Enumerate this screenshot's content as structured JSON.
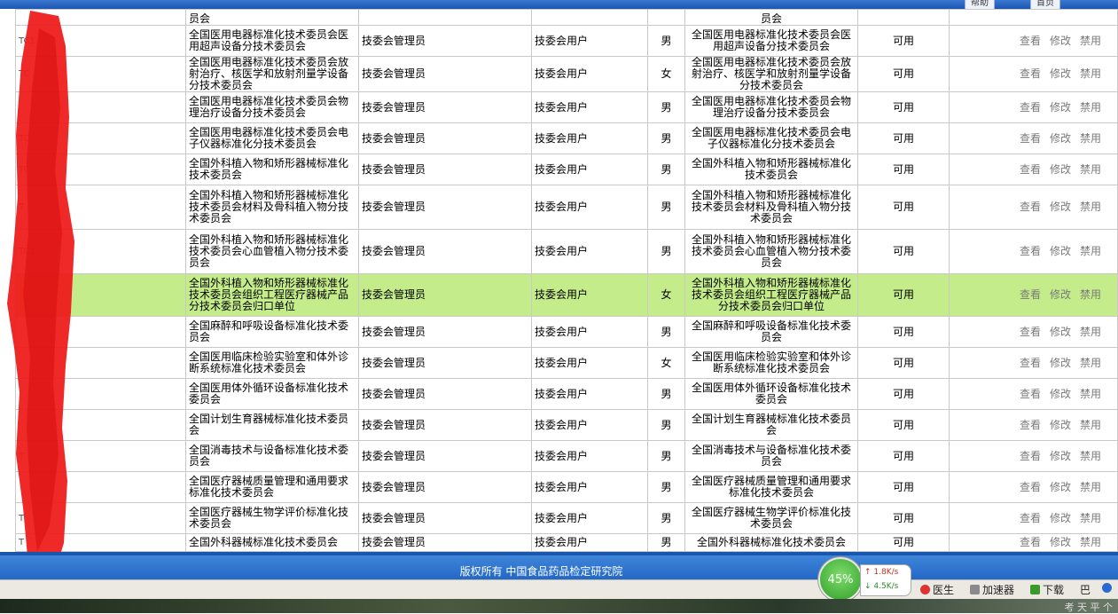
{
  "toolbar": {
    "btn1": "帮助",
    "btn2": "首页"
  },
  "table": {
    "top_partial": {
      "org": "员会",
      "org2": "员会"
    },
    "rows": [
      {
        "id": "TC1",
        "org": "全国医用电器标准化技术委员会医用超声设备分技术委员会",
        "role": "技委会管理员",
        "type": "技委会用户",
        "sex": "男",
        "org2": "全国医用电器标准化技术委员会医用超声设备分技术委员会",
        "status": "可用"
      },
      {
        "id": "TC",
        "org": "全国医用电器标准化技术委员会放射治疗、核医学和放射剂量学设备分技术委员会",
        "role": "技委会管理员",
        "type": "技委会用户",
        "sex": "女",
        "org2": "全国医用电器标准化技术委员会放射治疗、核医学和放射剂量学设备分技术委员会",
        "status": "可用"
      },
      {
        "id": "",
        "org": "全国医用电器标准化技术委员会物理治疗设备分技术委员会",
        "role": "技委会管理员",
        "type": "技委会用户",
        "sex": "男",
        "org2": "全国医用电器标准化技术委员会物理治疗设备分技术委员会",
        "status": "可用"
      },
      {
        "id": "TC",
        "org": "全国医用电器标准化技术委员会电子仪器标准化分技术委员会",
        "role": "技委会管理员",
        "type": "技委会用户",
        "sex": "男",
        "org2": "全国医用电器标准化技术委员会电子仪器标准化分技术委员会",
        "status": "可用"
      },
      {
        "id": "TC",
        "org": "全国外科植入物和矫形器械标准化技术委员会",
        "role": "技委会管理员",
        "type": "技委会用户",
        "sex": "男",
        "org2": "全国外科植入物和矫形器械标准化技术委员会",
        "status": "可用"
      },
      {
        "id": "T",
        "org": "全国外科植入物和矫形器械标准化技术委员会材料及骨科植入物分技术委员会",
        "role": "技委会管理员",
        "type": "技委会用户",
        "sex": "男",
        "org2": "全国外科植入物和矫形器械标准化技术委员会材料及骨科植入物分技术委员会",
        "status": "可用"
      },
      {
        "id": "TC1",
        "org": "全国外科植入物和矫形器械标准化技术委员会心血管植入物分技术委员会",
        "role": "技委会管理员",
        "type": "技委会用户",
        "sex": "男",
        "org2": "全国外科植入物和矫形器械标准化技术委员会心血管植入物分技术委员会",
        "status": "可用"
      },
      {
        "id": "",
        "org": "全国外科植入物和矫形器械标准化技术委员会组织工程医疗器械产品分技术委员会归口单位",
        "role": "技委会管理员",
        "type": "技委会用户",
        "sex": "女",
        "org2": "全国外科植入物和矫形器械标准化技术委员会组织工程医疗器械产品分技术委员会归口单位",
        "status": "可用",
        "highlight": true
      },
      {
        "id": "",
        "org": "全国麻醉和呼吸设备标准化技术委员会",
        "role": "技委会管理员",
        "type": "技委会用户",
        "sex": "男",
        "org2": "全国麻醉和呼吸设备标准化技术委员会",
        "status": "可用"
      },
      {
        "id": "",
        "org": "全国医用临床检验实验室和体外诊断系统标准化技术委员会",
        "role": "技委会管理员",
        "type": "技委会用户",
        "sex": "女",
        "org2": "全国医用临床检验实验室和体外诊断系统标准化技术委员会",
        "status": "可用"
      },
      {
        "id": "",
        "org": "全国医用体外循环设备标准化技术委员会",
        "role": "技委会管理员",
        "type": "技委会用户",
        "sex": "男",
        "org2": "全国医用体外循环设备标准化技术委员会",
        "status": "可用"
      },
      {
        "id": "",
        "org": "全国计划生育器械标准化技术委员会",
        "role": "技委会管理员",
        "type": "技委会用户",
        "sex": "男",
        "org2": "全国计划生育器械标准化技术委员会",
        "status": "可用"
      },
      {
        "id": "T",
        "org": "全国消毒技术与设备标准化技术委员会",
        "role": "技委会管理员",
        "type": "技委会用户",
        "sex": "男",
        "org2": "全国消毒技术与设备标准化技术委员会",
        "status": "可用"
      },
      {
        "id": "",
        "org": "全国医疗器械质量管理和通用要求标准化技术委员会",
        "role": "技委会管理员",
        "type": "技委会用户",
        "sex": "男",
        "org2": "全国医疗器械质量管理和通用要求标准化技术委员会",
        "status": "可用"
      },
      {
        "id": "T",
        "org": "全国医疗器械生物学评价标准化技术委员会",
        "role": "技委会管理员",
        "type": "技委会用户",
        "sex": "男",
        "org2": "全国医疗器械生物学评价标准化技术委员会",
        "status": "可用"
      },
      {
        "id": "T",
        "org": "全国外科器械标准化技术委员会",
        "role": "技委会管理员",
        "type": "技委会用户",
        "sex": "男",
        "org2": "全国外科器械标准化技术委员会",
        "status": "可用"
      }
    ],
    "actions": {
      "view": "查看",
      "edit": "修改",
      "disable": "禁用"
    }
  },
  "footer": {
    "copyright": "版权所有  中国食品药品检定研究院"
  },
  "statusbar": {
    "gauge": "45%",
    "upload": "1.8K/s",
    "download": "4.5K/s",
    "doctor": "医生",
    "accelerator": "加速器",
    "downloads": "下载",
    "misc": "巴"
  },
  "taskbar": {
    "tray_text": "考 天 平 个"
  }
}
